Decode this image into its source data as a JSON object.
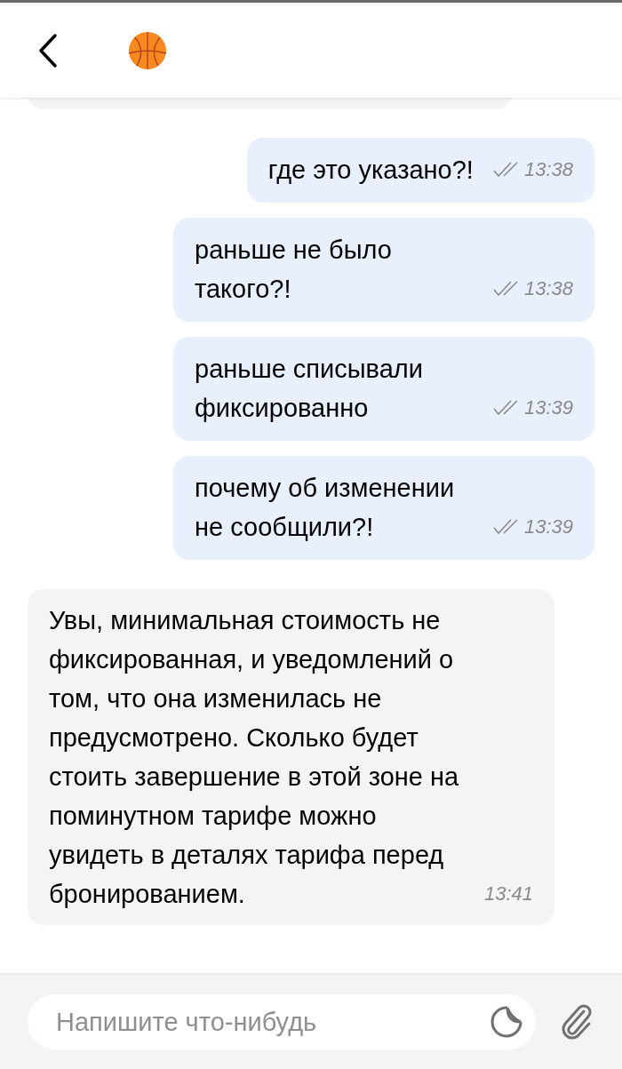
{
  "messages": [
    {
      "kind": "outgoing",
      "text": "где это указано?!",
      "time": "13:38",
      "read": true
    },
    {
      "kind": "outgoing",
      "text": "раньше не было такого?!",
      "time": "13:38",
      "read": true
    },
    {
      "kind": "outgoing",
      "text": "раньше списывали фиксированно",
      "time": "13:39",
      "read": true
    },
    {
      "kind": "outgoing",
      "text": "почему об изменении не сообщили?!",
      "time": "13:39",
      "read": true
    },
    {
      "kind": "incoming",
      "text": "Увы, минимальная стоимость не фиксированная, и уведомлений о том, что она изменилась не предусмотрено. Сколько будет стоить завершение в этой зоне на поминутном тарифе можно увидеть в деталях тарифа перед бронированием.",
      "time": "13:41",
      "read": false
    }
  ],
  "composer": {
    "placeholder": "Напишите что-нибудь"
  }
}
